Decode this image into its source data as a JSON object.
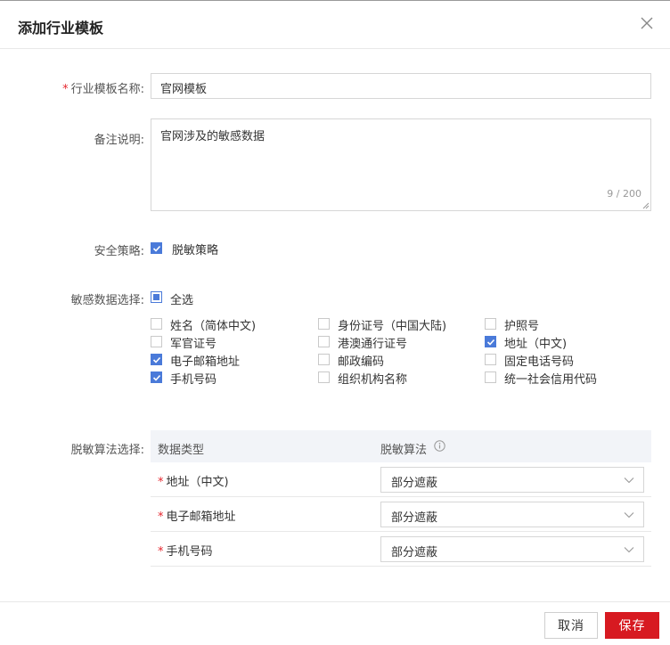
{
  "dialog": {
    "title": "添加行业模板",
    "close_label": "X"
  },
  "form": {
    "template_name": {
      "required_mark": "*",
      "label": "行业模板名称:",
      "value": "官网模板"
    },
    "remark": {
      "label": "备注说明:",
      "value": "官网涉及的敏感数据",
      "counter": "9 / 200"
    },
    "security_policy": {
      "label": "安全策略:",
      "option": "脱敏策略",
      "checked": true
    },
    "sensitive_data": {
      "label": "敏感数据选择:",
      "select_all": "全选",
      "options": [
        {
          "label": "姓名（简体中文)",
          "checked": false
        },
        {
          "label": "身份证号（中国大陆)",
          "checked": false
        },
        {
          "label": "护照号",
          "checked": false
        },
        {
          "label": "军官证号",
          "checked": false
        },
        {
          "label": "港澳通行证号",
          "checked": false
        },
        {
          "label": "地址（中文)",
          "checked": true
        },
        {
          "label": "电子邮箱地址",
          "checked": true
        },
        {
          "label": "邮政编码",
          "checked": false
        },
        {
          "label": "固定电话号码",
          "checked": false
        },
        {
          "label": "手机号码",
          "checked": true
        },
        {
          "label": "组织机构名称",
          "checked": false
        },
        {
          "label": "统一社会信用代码",
          "checked": false
        }
      ]
    },
    "algorithm": {
      "label": "脱敏算法选择:",
      "columns": [
        "数据类型",
        "脱敏算法"
      ],
      "rows": [
        {
          "required_mark": "*",
          "type": "地址（中文)",
          "algorithm": "部分遮蔽"
        },
        {
          "required_mark": "*",
          "type": "电子邮箱地址",
          "algorithm": "部分遮蔽"
        },
        {
          "required_mark": "*",
          "type": "手机号码",
          "algorithm": "部分遮蔽"
        }
      ]
    }
  },
  "footer": {
    "cancel_label": "取消",
    "save_label": "保存"
  },
  "colors": {
    "accent_blue": "#4a7ad9",
    "primary_red": "#d71a21",
    "required_red": "#e5262e"
  }
}
